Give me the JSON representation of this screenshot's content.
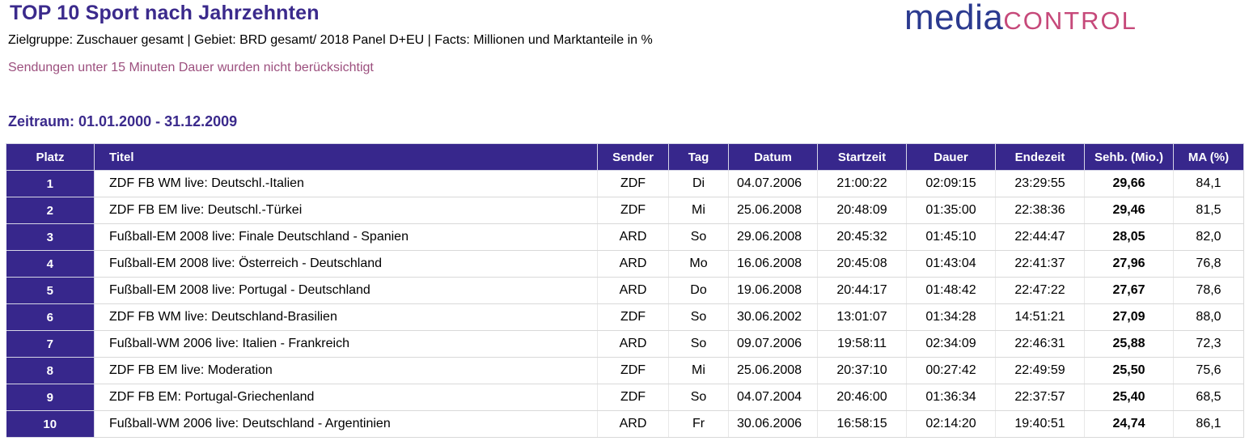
{
  "header": {
    "title": "TOP 10 Sport nach Jahrzehnten",
    "subtitle": "Zielgruppe: Zuschauer gesamt | Gebiet: BRD gesamt/ 2018 Panel D+EU | Facts: Millionen und Marktanteile in %",
    "note": "Sendungen unter 15 Minuten Dauer wurden nicht berücksichtigt",
    "period": "Zeitraum: 01.01.2000 - 31.12.2009"
  },
  "logo": {
    "part1": "media",
    "part2": "control"
  },
  "colors": {
    "accent": "#37278c",
    "note": "#9c4f7e",
    "logo_blue": "#2b3a8f",
    "logo_pink": "#c6497a"
  },
  "table": {
    "headers": {
      "platz": "Platz",
      "titel": "Titel",
      "sender": "Sender",
      "tag": "Tag",
      "datum": "Datum",
      "startzeit": "Startzeit",
      "dauer": "Dauer",
      "endezeit": "Endezeit",
      "sehb": "Sehb. (Mio.)",
      "ma": "MA (%)"
    },
    "rows": [
      {
        "platz": "1",
        "titel": "ZDF FB WM live: Deutschl.-Italien",
        "sender": "ZDF",
        "tag": "Di",
        "datum": "04.07.2006",
        "startzeit": "21:00:22",
        "dauer": "02:09:15",
        "endezeit": "23:29:55",
        "sehb": "29,66",
        "ma": "84,1"
      },
      {
        "platz": "2",
        "titel": "ZDF FB EM live: Deutschl.-Türkei",
        "sender": "ZDF",
        "tag": "Mi",
        "datum": "25.06.2008",
        "startzeit": "20:48:09",
        "dauer": "01:35:00",
        "endezeit": "22:38:36",
        "sehb": "29,46",
        "ma": "81,5"
      },
      {
        "platz": "3",
        "titel": "Fußball-EM 2008 live: Finale Deutschland - Spanien",
        "sender": "ARD",
        "tag": "So",
        "datum": "29.06.2008",
        "startzeit": "20:45:32",
        "dauer": "01:45:10",
        "endezeit": "22:44:47",
        "sehb": "28,05",
        "ma": "82,0"
      },
      {
        "platz": "4",
        "titel": "Fußball-EM 2008 live: Österreich - Deutschland",
        "sender": "ARD",
        "tag": "Mo",
        "datum": "16.06.2008",
        "startzeit": "20:45:08",
        "dauer": "01:43:04",
        "endezeit": "22:41:37",
        "sehb": "27,96",
        "ma": "76,8"
      },
      {
        "platz": "5",
        "titel": "Fußball-EM 2008 live: Portugal - Deutschland",
        "sender": "ARD",
        "tag": "Do",
        "datum": "19.06.2008",
        "startzeit": "20:44:17",
        "dauer": "01:48:42",
        "endezeit": "22:47:22",
        "sehb": "27,67",
        "ma": "78,6"
      },
      {
        "platz": "6",
        "titel": "ZDF FB WM live: Deutschland-Brasilien",
        "sender": "ZDF",
        "tag": "So",
        "datum": "30.06.2002",
        "startzeit": "13:01:07",
        "dauer": "01:34:28",
        "endezeit": "14:51:21",
        "sehb": "27,09",
        "ma": "88,0"
      },
      {
        "platz": "7",
        "titel": "Fußball-WM 2006 live: Italien - Frankreich",
        "sender": "ARD",
        "tag": "So",
        "datum": "09.07.2006",
        "startzeit": "19:58:11",
        "dauer": "02:34:09",
        "endezeit": "22:46:31",
        "sehb": "25,88",
        "ma": "72,3"
      },
      {
        "platz": "8",
        "titel": "ZDF FB EM live: Moderation",
        "sender": "ZDF",
        "tag": "Mi",
        "datum": "25.06.2008",
        "startzeit": "20:37:10",
        "dauer": "00:27:42",
        "endezeit": "22:49:59",
        "sehb": "25,50",
        "ma": "75,6"
      },
      {
        "platz": "9",
        "titel": "ZDF FB EM: Portugal-Griechenland",
        "sender": "ZDF",
        "tag": "So",
        "datum": "04.07.2004",
        "startzeit": "20:46:00",
        "dauer": "01:36:34",
        "endezeit": "22:37:57",
        "sehb": "25,40",
        "ma": "68,5"
      },
      {
        "platz": "10",
        "titel": "Fußball-WM 2006 live: Deutschland - Argentinien",
        "sender": "ARD",
        "tag": "Fr",
        "datum": "30.06.2006",
        "startzeit": "16:58:15",
        "dauer": "02:14:20",
        "endezeit": "19:40:51",
        "sehb": "24,74",
        "ma": "86,1"
      }
    ]
  }
}
